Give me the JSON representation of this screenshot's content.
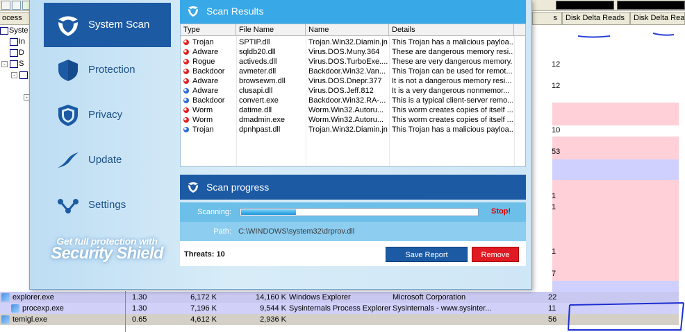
{
  "background_app": {
    "header_process": "ocess",
    "header_disk_delta_reads_1": "Disk Delta Reads",
    "header_disk_delta_reads_2": "Disk Delta Reads",
    "header_truncated_s": "s",
    "tree_items": [
      "Syste",
      "In",
      "D",
      "S",
      ""
    ],
    "right_numbers": [
      "12",
      "12",
      "10",
      "53",
      "1",
      "1",
      "1",
      "7"
    ],
    "processes": [
      {
        "name": "explorer.exe",
        "cpu": "1.30",
        "private": "6,172 K",
        "working": "14,160 K",
        "desc": "Windows Explorer",
        "company": "Microsoft Corporation",
        "col": "22",
        "color": "#c8c8f0"
      },
      {
        "name": "procexp.exe",
        "cpu": "1.30",
        "private": "7,196 K",
        "working": "9,544 K",
        "desc": "Sysinternals Process Explorer",
        "company": "Sysinternals - www.sysinter...",
        "col": "11",
        "color": "#d0d0f8"
      },
      {
        "name": "temigl.exe",
        "cpu": "0.65",
        "private": "4,612 K",
        "working": "2,936 K",
        "desc": "",
        "company": "",
        "col": "56",
        "color": "#d4d0c8"
      }
    ]
  },
  "app": {
    "nav": [
      {
        "label": "System Scan",
        "icon": "shield-scan-icon",
        "active": true
      },
      {
        "label": "Protection",
        "icon": "shield-icon",
        "active": false
      },
      {
        "label": "Privacy",
        "icon": "privacy-shield-icon",
        "active": false
      },
      {
        "label": "Update",
        "icon": "update-swoosh-icon",
        "active": false
      },
      {
        "label": "Settings",
        "icon": "settings-nodes-icon",
        "active": false
      }
    ],
    "promo_line1": "Get full protection with",
    "promo_line2": "Security Shield",
    "results_title": "Scan Results",
    "columns": [
      "Type",
      "File Name",
      "Name",
      "Details"
    ],
    "rows": [
      {
        "severity": "red",
        "type": "Trojan",
        "file": "SPTIP.dll",
        "name": "Trojan.Win32.Diamin.jn",
        "details": "This Trojan has a malicious payloa..."
      },
      {
        "severity": "red",
        "type": "Adware",
        "file": "sqldb20.dll",
        "name": "Virus.DOS.Muny.364",
        "details": "These are dangerous memory resi..."
      },
      {
        "severity": "red",
        "type": "Rogue",
        "file": "activeds.dll",
        "name": "Virus.DOS.TurboExe....",
        "details": "These are very dangerous memory..."
      },
      {
        "severity": "red",
        "type": "Backdoor",
        "file": "avmeter.dll",
        "name": "Backdoor.Win32.Van...",
        "details": "This Trojan can be used for remot..."
      },
      {
        "severity": "red",
        "type": "Adware",
        "file": "browsewm.dll",
        "name": "Virus.DOS.Dnepr.377",
        "details": "It is not a dangerous memory resi..."
      },
      {
        "severity": "blue",
        "type": "Adware",
        "file": "clusapi.dll",
        "name": "Virus.DOS.Jeff.812",
        "details": "It is a very dangerous nonmemor..."
      },
      {
        "severity": "blue",
        "type": "Backdoor",
        "file": "convert.exe",
        "name": "Backdoor.Win32.RA-...",
        "details": "This is a typical client-server remo..."
      },
      {
        "severity": "red",
        "type": "Worm",
        "file": "datime.dll",
        "name": "Worm.Win32.Autoru...",
        "details": "This worm creates copies of itself ..."
      },
      {
        "severity": "red",
        "type": "Worm",
        "file": "dmadmin.exe",
        "name": "Worm.Win32.Autoru...",
        "details": "This worm creates copies of itself ..."
      },
      {
        "severity": "blue",
        "type": "Trojan",
        "file": "dpnhpast.dll",
        "name": "Trojan.Win32.Diamin.jn",
        "details": "This Trojan has a malicious payloa..."
      }
    ],
    "progress_title": "Scan progress",
    "scanning_label": "Scanning:",
    "progress_fraction": 0.23,
    "stop_label": "Stop!",
    "path_label": "Path:",
    "path_value": "C:\\WINDOWS\\system32\\drprov.dll",
    "threats_text": "Threats: 10",
    "save_label": "Save Report",
    "remove_label": "Remove",
    "colors": {
      "accent_dark": "#1c5aa4",
      "accent_light": "#38a8e6",
      "danger": "#e01a22",
      "severity_red": "#e02020",
      "severity_blue": "#2a6ad8"
    }
  }
}
